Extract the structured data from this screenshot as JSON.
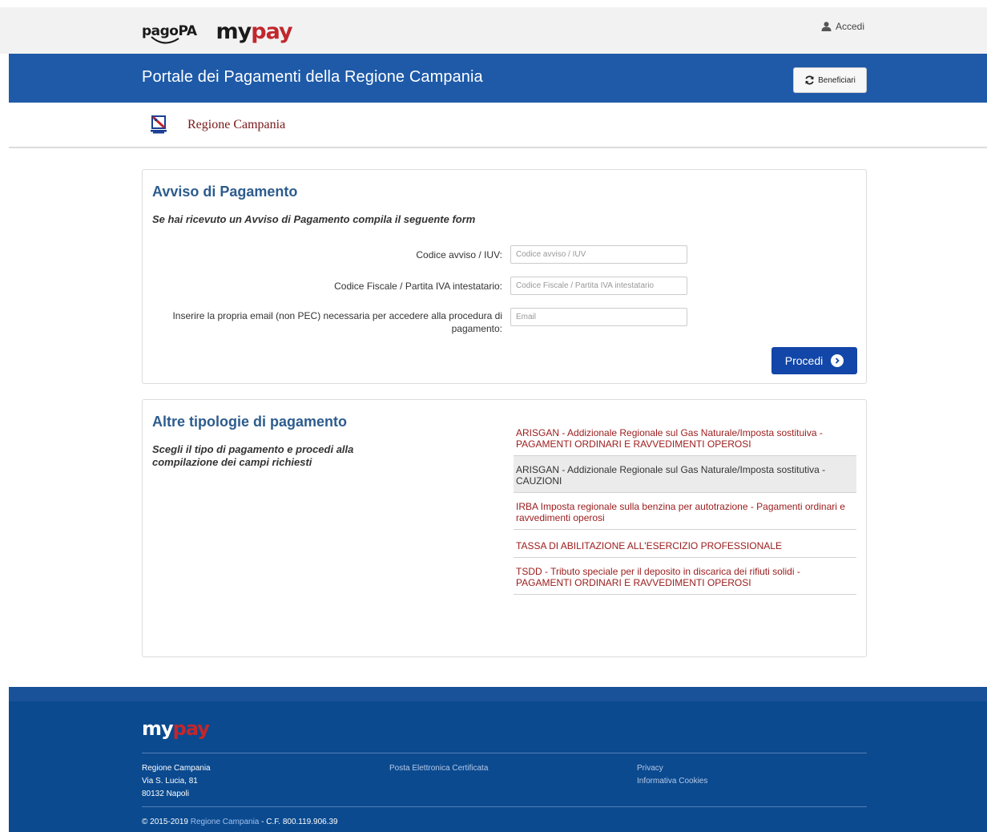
{
  "header": {
    "pagopa_logo_text": "pagoPA",
    "mypay_my": "my",
    "mypay_pay": "pay",
    "login_label": "Accedi"
  },
  "banner": {
    "title": "Portale dei Pagamenti della Regione Campania",
    "beneficiari_label": "Beneficiari"
  },
  "region": {
    "name": "Regione Campania"
  },
  "avviso": {
    "title": "Avviso di Pagamento",
    "subtitle": "Se hai ricevuto un Avviso di Pagamento compila il seguente form",
    "fields": [
      {
        "label": "Codice avviso / IUV:",
        "placeholder": "Codice avviso / IUV",
        "value": ""
      },
      {
        "label": "Codice Fiscale / Partita IVA intestatario:",
        "placeholder": "Codice Fiscale / Partita IVA intestatario",
        "value": ""
      },
      {
        "label": "Inserire la propria email (non PEC) necessaria per accedere alla procedura di pagamento:",
        "placeholder": "Email",
        "value": ""
      }
    ],
    "submit_label": "Procedi"
  },
  "altre": {
    "title": "Altre tipologie di pagamento",
    "subtitle": "Scegli il tipo di pagamento e procedi alla compilazione dei campi richiesti",
    "items": [
      {
        "label": "ARISGAN - Addizionale Regionale sul Gas Naturale/Imposta sostituiva - PAGAMENTI ORDINARI E RAVVEDIMENTI OPEROSI"
      },
      {
        "label": "ARISGAN - Addizionale Regionale sul Gas Naturale/Imposta sostitutiva - CAUZIONI"
      },
      {
        "label": "IRBA Imposta regionale sulla benzina per autotrazione - Pagamenti ordinari e ravvedimenti operosi"
      },
      {
        "label": "TASSA DI ABILITAZIONE ALL'ESERCIZIO PROFESSIONALE"
      },
      {
        "label": "TSDD - Tributo speciale per il deposito in discarica dei rifiuti solidi - PAGAMENTI ORDINARI E RAVVEDIMENTI OPEROSI"
      }
    ],
    "hovered_index": 1
  },
  "footer": {
    "logo_my": "my",
    "logo_pay": "pay",
    "address": [
      "Regione Campania",
      "Via S. Lucia, 81",
      "80132 Napoli"
    ],
    "pec_link": "Posta Elettronica Certificata",
    "privacy_link": "Privacy",
    "cookies_link": "Informativa Cookies",
    "copyright_prefix": "© 2015-2019 ",
    "copyright_link": "Regione Campania",
    "copyright_suffix": " - C.F. 800.119.906.39"
  },
  "colors": {
    "brand_blue": "#1e5aa8",
    "button_blue": "#1246a8",
    "link_red": "#9b1b1b",
    "footer_blue": "#0b4a8f",
    "logo_red": "#c1272d"
  }
}
